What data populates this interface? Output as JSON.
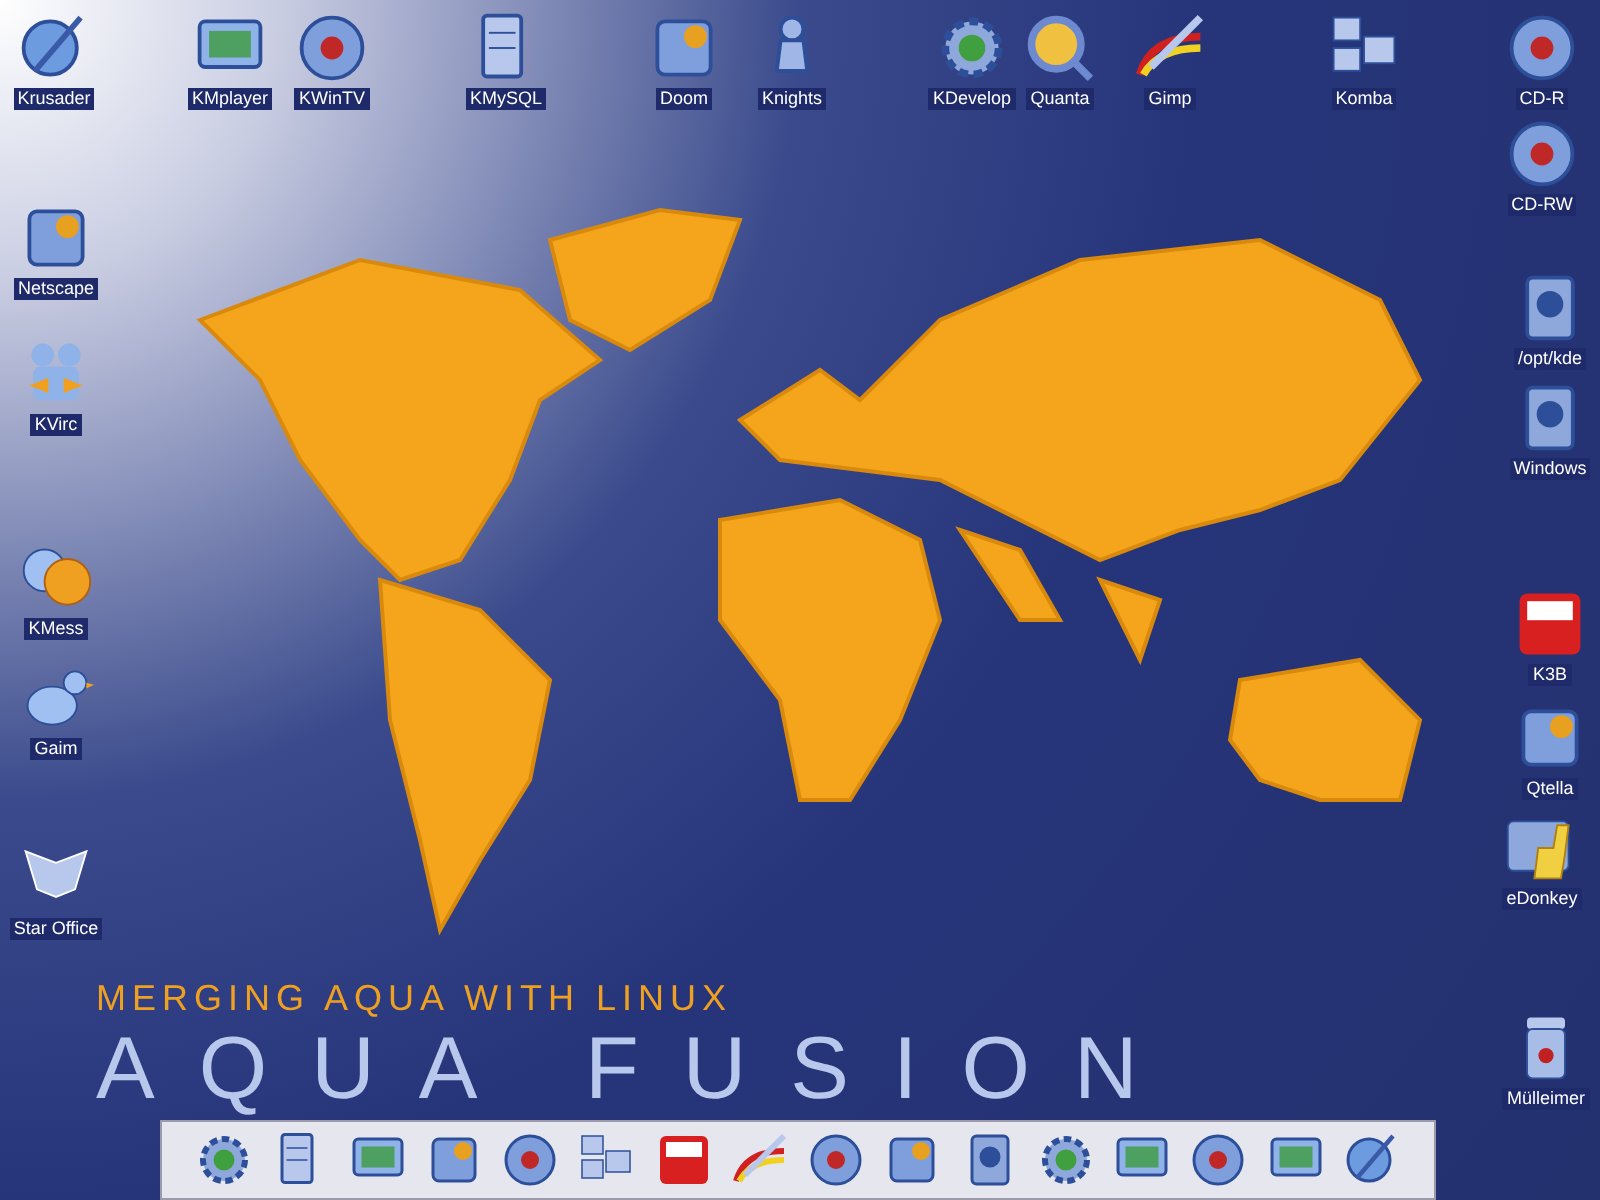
{
  "desktop_icons": [
    {
      "label": "Krusader"
    },
    {
      "label": "KMplayer"
    },
    {
      "label": "KWinTV"
    },
    {
      "label": "KMySQL"
    },
    {
      "label": "Doom"
    },
    {
      "label": "Knights"
    },
    {
      "label": "KDevelop"
    },
    {
      "label": "Quanta"
    },
    {
      "label": "Gimp"
    },
    {
      "label": "Komba"
    },
    {
      "label": "CD-R"
    },
    {
      "label": "Netscape"
    },
    {
      "label": "CD-RW"
    },
    {
      "label": "/opt/kde"
    },
    {
      "label": "KVirc"
    },
    {
      "label": "Windows"
    },
    {
      "label": "KMess"
    },
    {
      "label": "K3B"
    },
    {
      "label": "Gaim"
    },
    {
      "label": "Qtella"
    },
    {
      "label": "eDonkey"
    },
    {
      "label": "Star Office"
    },
    {
      "label": "Mülleimer"
    }
  ],
  "wallpaper": {
    "tagline": "MERGING AQUA WITH LINUX",
    "title": "AQUA FUSION"
  }
}
